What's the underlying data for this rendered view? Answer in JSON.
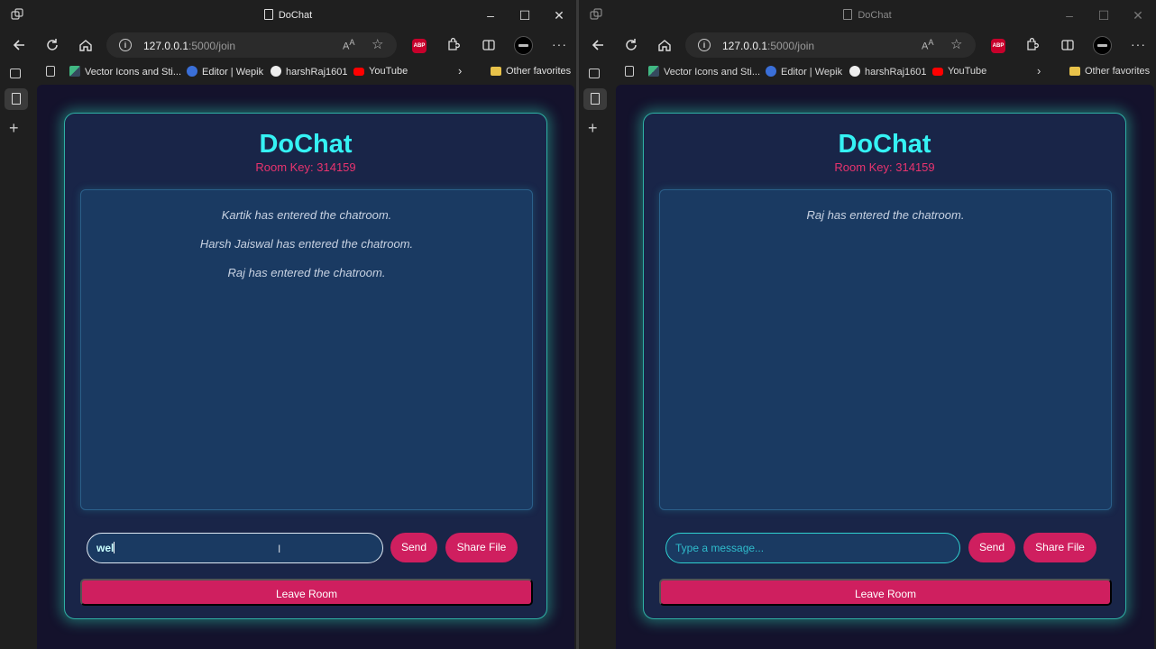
{
  "windows": [
    {
      "title": "DoChat",
      "url_host": "127.0.0.1",
      "url_path": ":5000/join",
      "bookmarks": [
        "Vector Icons and Sti...",
        "Editor | Wepik",
        "harshRaj1601",
        "YouTube"
      ],
      "other_favorites": "Other favorites",
      "brand": "DoChat",
      "room_key": "Room Key: 314159",
      "messages": [
        "Kartik has entered the chatroom.",
        "Harsh Jaiswal has entered the chatroom.",
        "Raj has entered the chatroom."
      ],
      "input_value": "wel",
      "input_placeholder": "",
      "send_label": "Send",
      "share_label": "Share File",
      "leave_label": "Leave Room"
    },
    {
      "title": "DoChat",
      "url_host": "127.0.0.1",
      "url_path": ":5000/join",
      "bookmarks": [
        "Vector Icons and Sti...",
        "Editor | Wepik",
        "harshRaj1601",
        "YouTube"
      ],
      "other_favorites": "Other favorites",
      "brand": "DoChat",
      "room_key": "Room Key: 314159",
      "messages": [
        "Raj has entered the chatroom."
      ],
      "input_value": "",
      "input_placeholder": "Type a message...",
      "send_label": "Send",
      "share_label": "Share File",
      "leave_label": "Leave Room"
    }
  ],
  "colors": {
    "brand": "#35f2f4",
    "accent": "#cf1f5f",
    "room_key": "#e8336e",
    "card_glow": "#2fb0a4",
    "page_bg": "#14122c"
  },
  "icons": {
    "titlebar": [
      "workspaces-icon",
      "page-icon",
      "minimize-icon",
      "maximize-icon",
      "close-icon"
    ],
    "toolbar": [
      "back-icon",
      "refresh-icon",
      "home-icon",
      "info-icon",
      "read-aloud-icon",
      "favorite-star-icon",
      "adblock-plus-icon",
      "extensions-icon",
      "split-screen-icon",
      "profile-avatar",
      "more-menu-icon"
    ],
    "favorites": [
      "page-icon",
      "vue-logo-icon",
      "globe-icon",
      "github-icon",
      "youtube-icon",
      "chevron-right-icon",
      "folder-icon"
    ],
    "sidebar": [
      "tab-actions-icon",
      "page-icon",
      "new-tab-icon"
    ]
  }
}
